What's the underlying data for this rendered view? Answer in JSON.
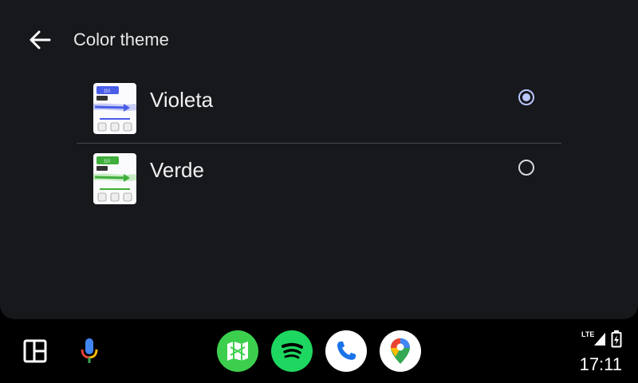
{
  "header": {
    "title": "Color theme"
  },
  "options": [
    {
      "label": "Violeta",
      "selected": true,
      "accent": "#4a5ee8",
      "badge": "110"
    },
    {
      "label": "Verde",
      "selected": false,
      "accent": "#3fae3a",
      "badge": "110"
    }
  ],
  "dock": {
    "left_buttons": [
      "layout-icon",
      "microphone-icon"
    ],
    "apps": [
      {
        "name": "maps-navigation-app",
        "color": "#3ccf4e"
      },
      {
        "name": "spotify-app",
        "color": "#1ed760"
      },
      {
        "name": "phone-app",
        "color": "#ffffff"
      },
      {
        "name": "google-maps-app",
        "color": "#ffffff"
      }
    ]
  },
  "status": {
    "network": "LTE",
    "time": "17:11"
  },
  "colors": {
    "background": "#17181c",
    "radio_selected": "#b9c7ff",
    "dock": "#000000"
  }
}
